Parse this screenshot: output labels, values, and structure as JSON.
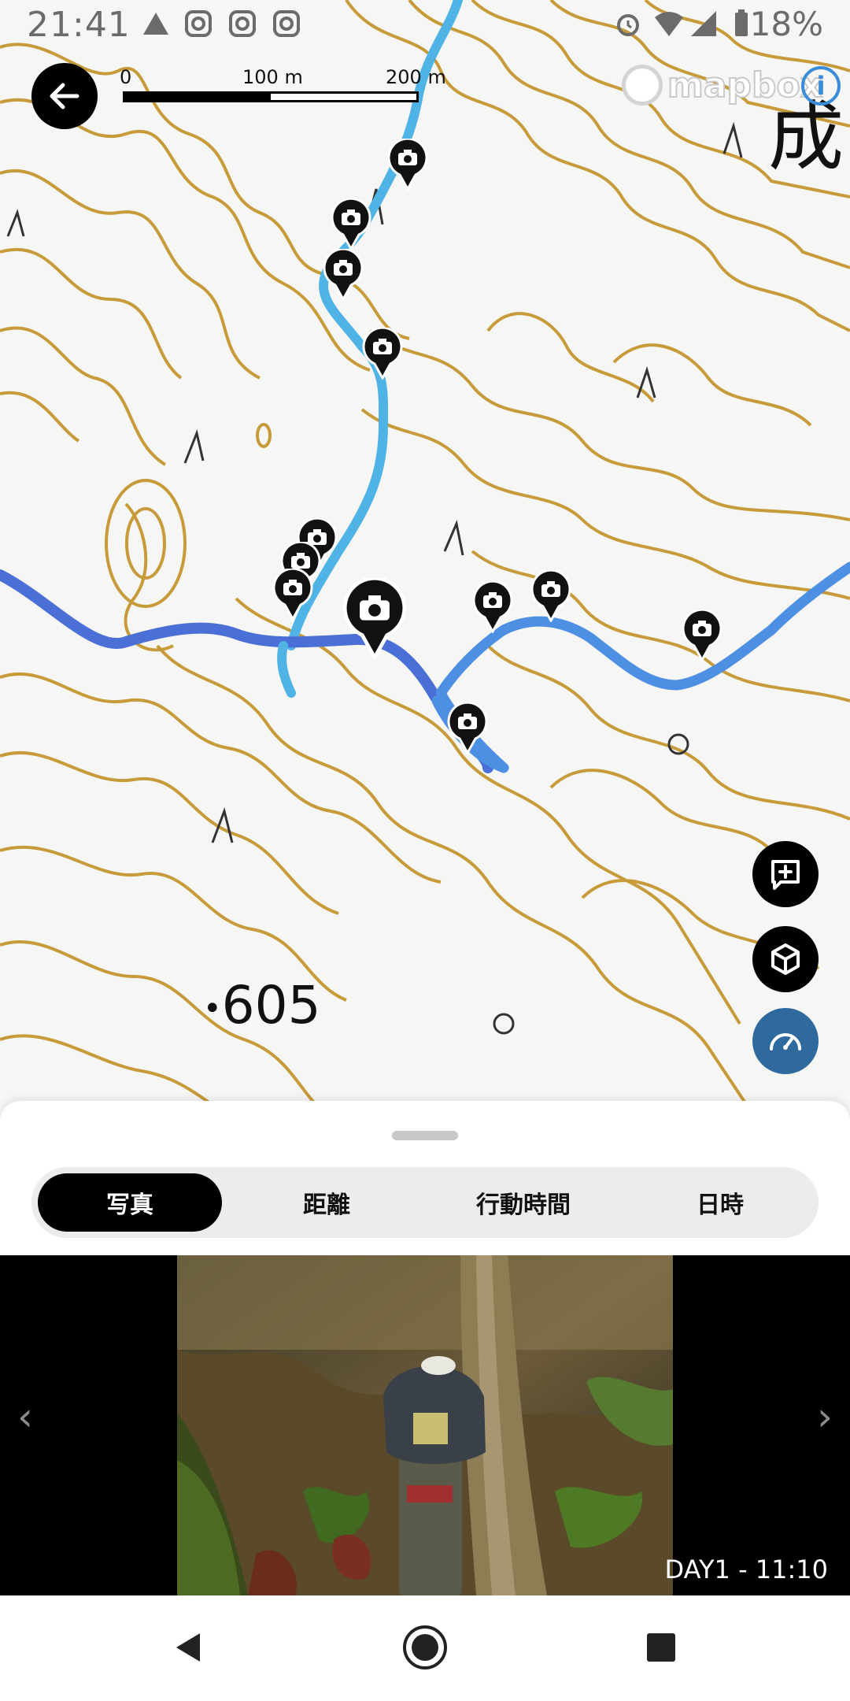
{
  "status_bar": {
    "time": "21:41",
    "battery": "18%",
    "icons": [
      "alert-icon",
      "instagram-icon",
      "instagram-icon",
      "instagram-icon",
      "alarm-icon",
      "wifi-icon",
      "signal-icon",
      "battery-icon"
    ]
  },
  "map": {
    "scale": {
      "tick_start": "0",
      "tick_mid": "100 m",
      "tick_end": "200 m"
    },
    "attribution": "mapbox",
    "place_label": "成",
    "elevation_label": "605",
    "colors": {
      "contour": "#c79a3a",
      "route_light": "#4fb3e6",
      "route_dark": "#4a6fd6",
      "background": "#f6f6f4"
    },
    "photo_marker_count": 13
  },
  "back_button": {
    "icon": "arrow-left-icon"
  },
  "fabs": [
    {
      "icon": "add-photo-icon"
    },
    {
      "icon": "cube-3d-icon"
    },
    {
      "icon": "speedometer-icon"
    }
  ],
  "sheet": {
    "tabs": [
      {
        "label": "写真",
        "active": true
      },
      {
        "label": "距離",
        "active": false
      },
      {
        "label": "行動時間",
        "active": false
      },
      {
        "label": "日時",
        "active": false
      }
    ],
    "photo": {
      "caption": "DAY1 - 11:10",
      "prev": "‹",
      "next": "›"
    }
  },
  "nav_bar": {
    "icons": [
      "back-triangle-icon",
      "home-circle-icon",
      "recents-square-icon"
    ]
  }
}
